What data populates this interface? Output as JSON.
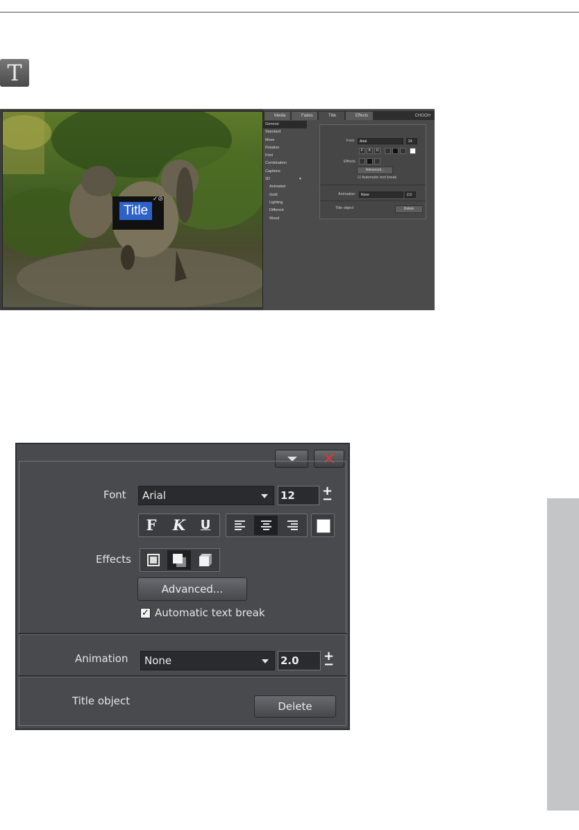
{
  "page": {
    "icon": "title-t-icon",
    "icon_glyph": "T"
  },
  "screenshot": {
    "title_text": "Title",
    "logo": "CHOOH",
    "tabs": [
      {
        "label": "Media",
        "icon": "media-icon"
      },
      {
        "label": "Fades",
        "icon": "fades-icon"
      },
      {
        "label": "Title",
        "icon": "title-icon"
      },
      {
        "label": "Effects",
        "icon": "effects-icon"
      }
    ],
    "categories": [
      {
        "label": "General"
      },
      {
        "label": "Standard"
      },
      {
        "label": "Move"
      },
      {
        "label": "Rotation"
      },
      {
        "label": "Font"
      },
      {
        "label": "Combination"
      },
      {
        "label": "Captions"
      },
      {
        "label": "3D"
      },
      {
        "label": "Animated"
      },
      {
        "label": "Gold"
      },
      {
        "label": "Lighting"
      },
      {
        "label": "Different"
      },
      {
        "label": "Wood"
      }
    ],
    "font_label": "Font",
    "font_value": "Arial",
    "font_size": "24",
    "effects_label": "Effects",
    "advanced_label": "Advanced...",
    "auto_break_label": "Automatic text break",
    "animation_label": "Animation",
    "animation_value": "None",
    "animation_duration": "2.0",
    "title_object_label": "Title object",
    "delete_label": "Delete"
  },
  "panel": {
    "collapse_icon": "chevron-down-icon",
    "close_icon": "close-icon",
    "font_label": "Font",
    "font_value": "Arial",
    "font_size": "12",
    "style_buttons": [
      {
        "glyph": "F",
        "icon": "bold-icon"
      },
      {
        "glyph": "K",
        "icon": "italic-icon"
      },
      {
        "glyph": "U",
        "icon": "underline-icon"
      }
    ],
    "align_buttons": [
      {
        "icon": "align-left-icon",
        "active": false
      },
      {
        "icon": "align-center-icon",
        "active": true
      },
      {
        "icon": "align-right-icon",
        "active": false
      }
    ],
    "color_icon": "text-color-icon",
    "effects_label": "Effects",
    "effect_buttons": [
      {
        "icon": "outline-effect-icon",
        "active": false
      },
      {
        "icon": "shadow-effect-icon",
        "active": true
      },
      {
        "icon": "3d-effect-icon",
        "active": false
      }
    ],
    "advanced_label": "Advanced...",
    "auto_break_checked": true,
    "auto_break_label": "Automatic text break",
    "animation_label": "Animation",
    "animation_value": "None",
    "animation_duration": "2.0",
    "title_object_label": "Title object",
    "delete_label": "Delete",
    "plus_minus": "±"
  }
}
